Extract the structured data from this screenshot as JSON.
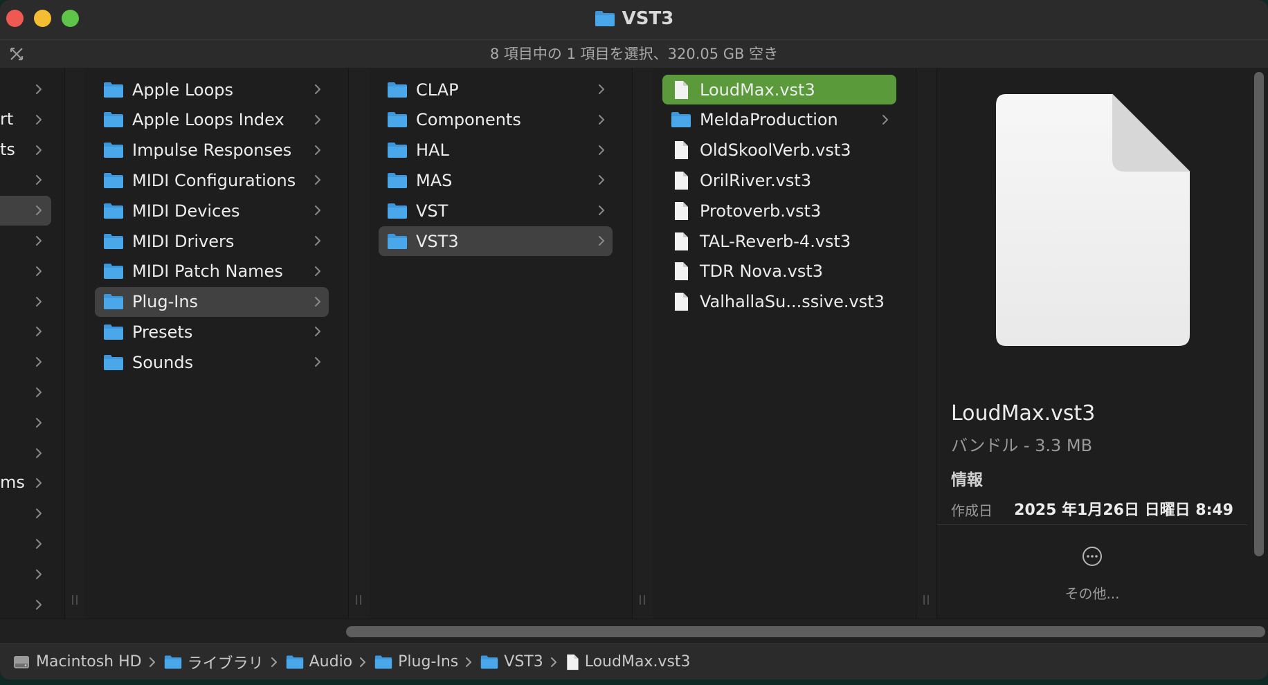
{
  "window": {
    "title": "VST3",
    "status": "8 項目中の 1 項目を選択、320.05 GB 空き"
  },
  "columns": {
    "leftmost_partial": [
      "rt",
      "ts",
      "ms"
    ],
    "library_audio": [
      {
        "label": "Apple Loops"
      },
      {
        "label": "Apple Loops Index"
      },
      {
        "label": "Impulse Responses"
      },
      {
        "label": "MIDI Configurations"
      },
      {
        "label": "MIDI Devices"
      },
      {
        "label": "MIDI Drivers"
      },
      {
        "label": "MIDI Patch Names"
      },
      {
        "label": "Plug-Ins"
      },
      {
        "label": "Presets"
      },
      {
        "label": "Sounds"
      }
    ],
    "plugins": [
      {
        "label": "CLAP"
      },
      {
        "label": "Components"
      },
      {
        "label": "HAL"
      },
      {
        "label": "MAS"
      },
      {
        "label": "VST"
      },
      {
        "label": "VST3"
      }
    ],
    "vst3": [
      {
        "label": "LoudMax.vst3"
      },
      {
        "label": "MeldaProduction"
      },
      {
        "label": "OldSkoolVerb.vst3"
      },
      {
        "label": "OrilRiver.vst3"
      },
      {
        "label": "Protoverb.vst3"
      },
      {
        "label": "TAL-Reverb-4.vst3"
      },
      {
        "label": "TDR Nova.vst3"
      },
      {
        "label": "ValhallaSu...ssive.vst3"
      }
    ]
  },
  "preview": {
    "name": "LoudMax.vst3",
    "kind": "バンドル - 3.3 MB",
    "info_heading": "情報",
    "created_label": "作成日",
    "created_value": "2025 年1月26日 日曜日 8:49",
    "more_label": "その他..."
  },
  "pathbar": {
    "items": [
      "Macintosh HD",
      "ライブラリ",
      "Audio",
      "Plug-Ins",
      "VST3",
      "LoudMax.vst3"
    ]
  },
  "colors": {
    "selection_green": "#5a9a3a",
    "selection_grey": "#414141",
    "folder_blue": "#4aa8ea",
    "close_red": "#ee5a52",
    "minimize_yellow": "#f5bd31",
    "zoom_green": "#5fc548"
  },
  "icons": {
    "folder": "folder-icon",
    "file": "document-icon",
    "chevron": "chevron-right-icon",
    "disk": "hard-disk-icon",
    "more": "ellipsis-circle-icon",
    "collapse": "collapse-icon"
  }
}
